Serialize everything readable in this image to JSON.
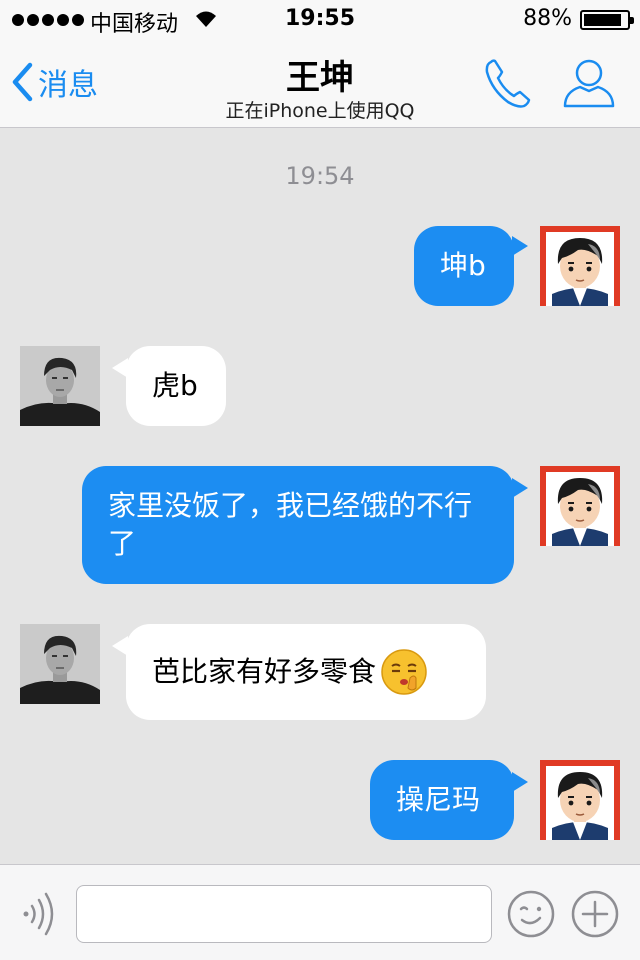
{
  "status_bar": {
    "carrier": "中国移动",
    "time": "19:55",
    "battery_percent": "88%",
    "battery_level": 0.88
  },
  "nav": {
    "back_label": "消息",
    "title": "王坤",
    "subtitle": "正在iPhone上使用QQ",
    "icons": {
      "back": "chevron-left-icon",
      "call": "phone-icon",
      "profile": "person-icon"
    }
  },
  "chat": {
    "timestamp": "19:54",
    "messages": [
      {
        "side": "out",
        "text": "坤b"
      },
      {
        "side": "in",
        "text": "虎b"
      },
      {
        "side": "out",
        "text": "家里没饭了，我已经饿的不行了"
      },
      {
        "side": "in",
        "text": "芭比家有好多零食",
        "emoji": "shush-emoji"
      },
      {
        "side": "out",
        "text": "操尼玛"
      }
    ]
  },
  "input_bar": {
    "placeholder": "",
    "icons": {
      "voice": "voice-icon",
      "emoji": "emoji-icon",
      "more": "plus-icon"
    }
  },
  "colors": {
    "accent": "#1a8cf0",
    "outgoing_bubble": "#1c8df2",
    "incoming_bubble": "#ffffff",
    "chat_background": "#e5e5e5"
  }
}
